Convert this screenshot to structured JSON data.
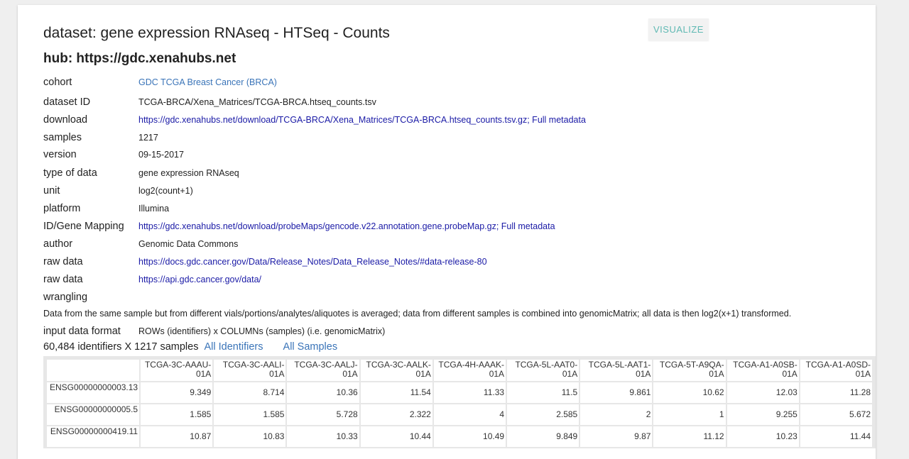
{
  "header": {
    "title": "dataset: gene expression RNAseq - HTSeq - Counts",
    "hub": "hub: https://gdc.xenahubs.net",
    "visualize_label": "VISUALIZE"
  },
  "meta": {
    "cohort": {
      "label": "cohort",
      "value": "GDC TCGA Breast Cancer (BRCA)"
    },
    "dataset_id": {
      "label": "dataset ID",
      "value": "TCGA-BRCA/Xena_Matrices/TCGA-BRCA.htseq_counts.tsv"
    },
    "download": {
      "label": "download",
      "value": "https://gdc.xenahubs.net/download/TCGA-BRCA/Xena_Matrices/TCGA-BRCA.htseq_counts.tsv.gz; Full metadata"
    },
    "samples": {
      "label": "samples",
      "value": "1217"
    },
    "version": {
      "label": "version",
      "value": "09-15-2017"
    },
    "type_of_data": {
      "label": "type of data",
      "value": "gene expression RNAseq"
    },
    "unit": {
      "label": "unit",
      "value": "log2(count+1)"
    },
    "platform": {
      "label": "platform",
      "value": "Illumina"
    },
    "id_mapping": {
      "label": "ID/Gene Mapping",
      "value": "https://gdc.xenahubs.net/download/probeMaps/gencode.v22.annotation.gene.probeMap.gz; Full metadata"
    },
    "author": {
      "label": "author",
      "value": "Genomic Data Commons"
    },
    "raw_data_1": {
      "label": "raw data",
      "value": "https://docs.gdc.cancer.gov/Data/Release_Notes/Data_Release_Notes/#data-release-80"
    },
    "raw_data_2": {
      "label": "raw data",
      "value": "https://api.gdc.cancer.gov/data/"
    },
    "wrangling": {
      "label": "wrangling",
      "value": "Data from the same sample but from different vials/portions/analytes/aliquotes is averaged; data from different samples is combined into genomicMatrix; all data is then log2(x+1) transformed."
    },
    "input_format": {
      "label": "input data format",
      "value": "ROWs (identifiers) x COLUMNs (samples) (i.e. genomicMatrix)"
    }
  },
  "summary": {
    "counts_text": "60,484 identifiers X 1217 samples",
    "all_identifiers": "All Identifiers",
    "all_samples": "All Samples"
  },
  "table": {
    "columns": [
      "TCGA-3C-AAAU-01A",
      "TCGA-3C-AALI-01A",
      "TCGA-3C-AALJ-01A",
      "TCGA-3C-AALK-01A",
      "TCGA-4H-AAAK-01A",
      "TCGA-5L-AAT0-01A",
      "TCGA-5L-AAT1-01A",
      "TCGA-5T-A9QA-01A",
      "TCGA-A1-A0SB-01A",
      "TCGA-A1-A0SD-01A"
    ],
    "rows": [
      {
        "id": "ENSG00000000003.13",
        "values": [
          "9.349",
          "8.714",
          "10.36",
          "11.54",
          "11.33",
          "11.5",
          "9.861",
          "10.62",
          "12.03",
          "11.28"
        ]
      },
      {
        "id": "ENSG00000000005.5",
        "values": [
          "1.585",
          "1.585",
          "5.728",
          "2.322",
          "4",
          "2.585",
          "2",
          "1",
          "9.255",
          "5.672"
        ]
      },
      {
        "id": "ENSG00000000419.11",
        "values": [
          "10.87",
          "10.83",
          "10.33",
          "10.44",
          "10.49",
          "9.849",
          "9.87",
          "11.12",
          "10.23",
          "11.44"
        ]
      }
    ]
  }
}
